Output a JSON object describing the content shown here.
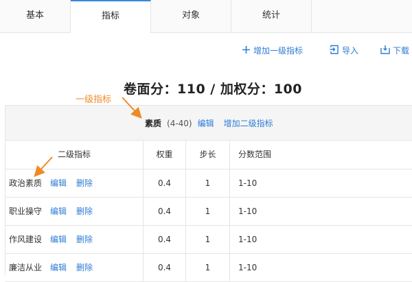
{
  "tabs": [
    "基本",
    "指标",
    "对象",
    "统计",
    ""
  ],
  "toolbar": {
    "add_label": "增加一级指标",
    "import_label": "导入",
    "download_label": "下载",
    "color": "#2e7bd6"
  },
  "score_heading": "卷面分：110 / 加权分：100",
  "annotations": {
    "level1": "一级指标",
    "color": "#f08a24"
  },
  "group": {
    "title": "素质",
    "range": "(4-40)",
    "edit_label": "编辑",
    "add_sub_label": "增加二级指标"
  },
  "table": {
    "headers": [
      "二级指标",
      "权重",
      "步长",
      "分数范围"
    ],
    "rows": [
      {
        "name": "政治素质",
        "weight": "0.4",
        "step": "1",
        "range": "1-10",
        "edit": "编辑",
        "delete": "删除"
      },
      {
        "name": "职业操守",
        "weight": "0.4",
        "step": "1",
        "range": "1-10",
        "edit": "编辑",
        "delete": "删除"
      },
      {
        "name": "作风建设",
        "weight": "0.4",
        "step": "1",
        "range": "1-10",
        "edit": "编辑",
        "delete": "删除"
      },
      {
        "name": "廉洁从业",
        "weight": "0.4",
        "step": "1",
        "range": "1-10",
        "edit": "编辑",
        "delete": "删除"
      }
    ]
  },
  "icons": {
    "add": "plus-icon",
    "import": "import-icon",
    "download": "download-icon"
  }
}
